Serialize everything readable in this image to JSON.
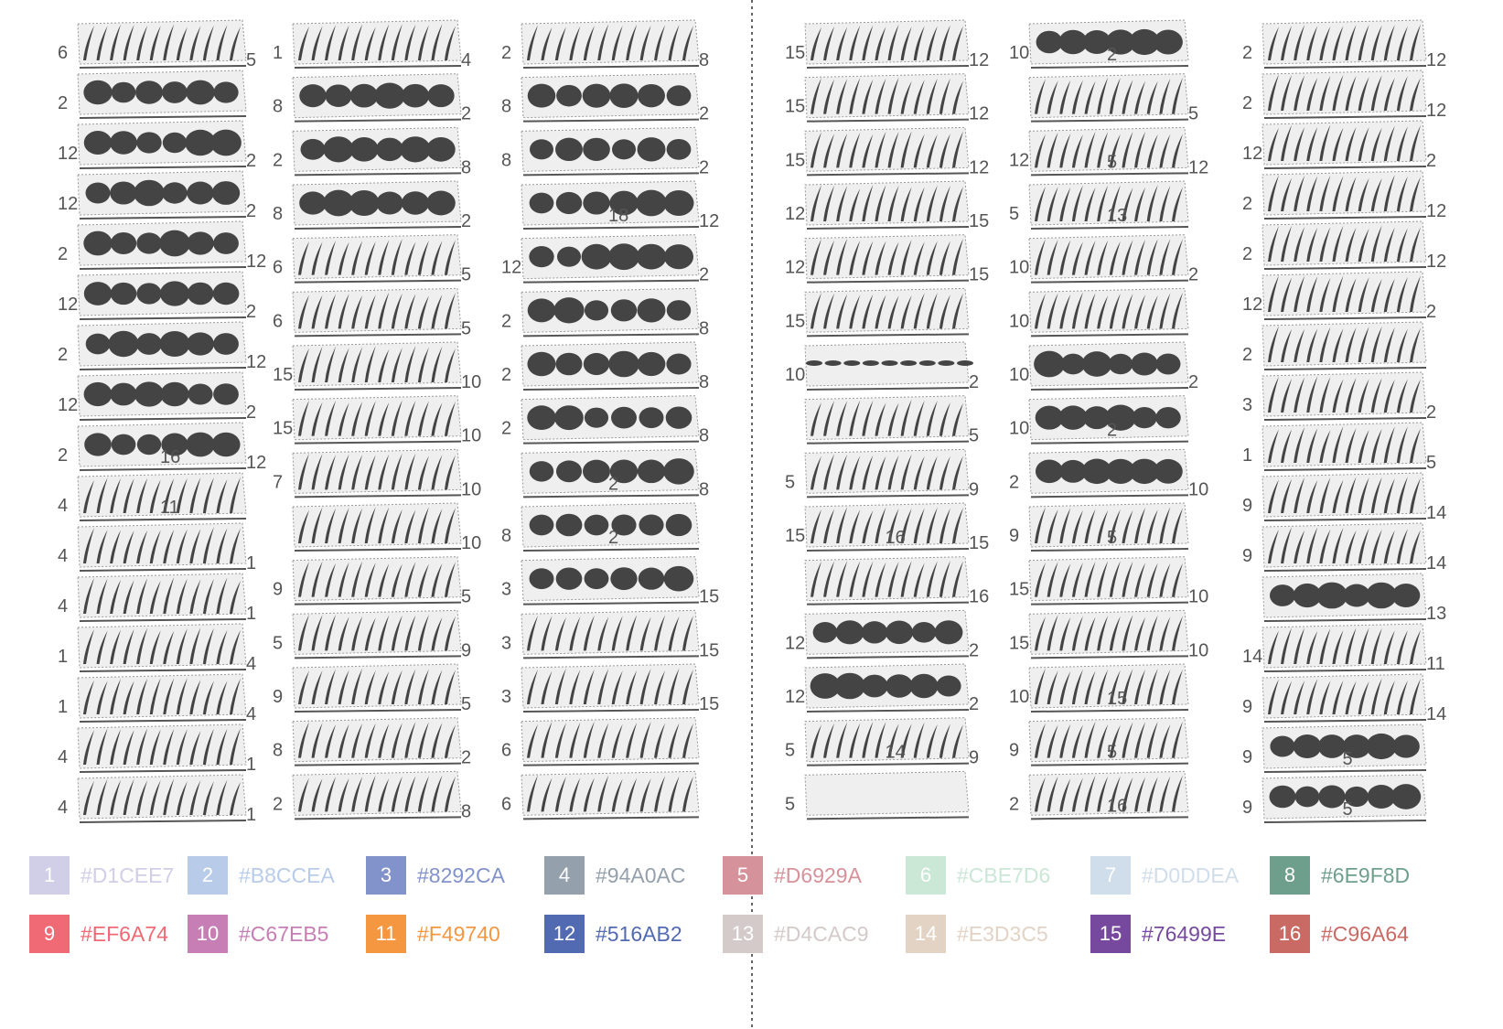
{
  "legend": [
    {
      "num": "1",
      "hex": "#D1CEE7"
    },
    {
      "num": "2",
      "hex": "#B8CCEA"
    },
    {
      "num": "3",
      "hex": "#8292CA"
    },
    {
      "num": "4",
      "hex": "#94A0AC"
    },
    {
      "num": "5",
      "hex": "#D6929A"
    },
    {
      "num": "6",
      "hex": "#CBE7D6"
    },
    {
      "num": "7",
      "hex": "#D0DDEA"
    },
    {
      "num": "8",
      "hex": "#6E9F8D"
    },
    {
      "num": "9",
      "hex": "#EF6A74"
    },
    {
      "num": "10",
      "hex": "#C67EB5"
    },
    {
      "num": "11",
      "hex": "#F49740"
    },
    {
      "num": "12",
      "hex": "#516AB2"
    },
    {
      "num": "13",
      "hex": "#D4CAC9"
    },
    {
      "num": "14",
      "hex": "#E3D3C5"
    },
    {
      "num": "15",
      "hex": "#76499E"
    },
    {
      "num": "16",
      "hex": "#C96A64"
    }
  ],
  "columns": [
    {
      "strips": [
        {
          "t": "s",
          "l": "6",
          "r": "5"
        },
        {
          "t": "b",
          "l": "2",
          "r": ""
        },
        {
          "t": "b",
          "l": "12",
          "r": "2"
        },
        {
          "t": "b",
          "l": "12",
          "r": "2"
        },
        {
          "t": "b",
          "l": "2",
          "r": "12"
        },
        {
          "t": "b",
          "l": "12",
          "r": "2"
        },
        {
          "t": "b",
          "l": "2",
          "r": "12"
        },
        {
          "t": "b",
          "l": "12",
          "r": "2"
        },
        {
          "t": "b",
          "l": "2",
          "r": "12",
          "m": "16"
        },
        {
          "t": "s",
          "l": "4",
          "r": "",
          "m": "11"
        },
        {
          "t": "s",
          "l": "4",
          "r": "1"
        },
        {
          "t": "s",
          "l": "4",
          "r": "1"
        },
        {
          "t": "s",
          "l": "1",
          "r": "4"
        },
        {
          "t": "s",
          "l": "1",
          "r": "4"
        },
        {
          "t": "s",
          "l": "4",
          "r": "1"
        },
        {
          "t": "s",
          "l": "4",
          "r": "1"
        }
      ]
    },
    {
      "strips": [
        {
          "t": "s",
          "l": "1",
          "r": "4"
        },
        {
          "t": "b",
          "l": "8",
          "r": "2"
        },
        {
          "t": "b",
          "l": "2",
          "r": "8"
        },
        {
          "t": "b",
          "l": "8",
          "r": "2"
        },
        {
          "t": "s",
          "l": "6",
          "r": "5"
        },
        {
          "t": "s",
          "l": "6",
          "r": "5"
        },
        {
          "t": "s",
          "l": "15",
          "r": "10"
        },
        {
          "t": "s",
          "l": "15",
          "r": "10"
        },
        {
          "t": "s",
          "l": "7",
          "r": "10"
        },
        {
          "t": "s",
          "l": "",
          "r": "10"
        },
        {
          "t": "s",
          "l": "9",
          "r": "5"
        },
        {
          "t": "s",
          "l": "5",
          "r": "9"
        },
        {
          "t": "s",
          "l": "9",
          "r": "5"
        },
        {
          "t": "s",
          "l": "8",
          "r": "2"
        },
        {
          "t": "s",
          "l": "2",
          "r": "8"
        }
      ]
    },
    {
      "strips": [
        {
          "t": "s",
          "l": "2",
          "r": "8"
        },
        {
          "t": "b",
          "l": "8",
          "r": "2"
        },
        {
          "t": "b",
          "l": "8",
          "r": "2"
        },
        {
          "t": "b",
          "l": "",
          "r": "12",
          "m": "18"
        },
        {
          "t": "b",
          "l": "12",
          "r": "2"
        },
        {
          "t": "b",
          "l": "2",
          "r": "8"
        },
        {
          "t": "b",
          "l": "2",
          "r": "8"
        },
        {
          "t": "b",
          "l": "2",
          "r": "8"
        },
        {
          "t": "b",
          "l": "",
          "r": "8",
          "m": "2"
        },
        {
          "t": "b",
          "l": "8",
          "r": "",
          "m": "2"
        },
        {
          "t": "b",
          "l": "3",
          "r": "15"
        },
        {
          "t": "s",
          "l": "3",
          "r": "15"
        },
        {
          "t": "s",
          "l": "3",
          "r": "15"
        },
        {
          "t": "s",
          "l": "6",
          "r": ""
        },
        {
          "t": "s",
          "l": "6",
          "r": ""
        }
      ]
    },
    {
      "strips": [
        {
          "t": "s",
          "l": "15",
          "r": "12"
        },
        {
          "t": "s",
          "l": "15",
          "r": "12"
        },
        {
          "t": "s",
          "l": "15",
          "r": "12"
        },
        {
          "t": "s",
          "l": "12",
          "r": "15"
        },
        {
          "t": "s",
          "l": "12",
          "r": "15"
        },
        {
          "t": "s",
          "l": "15",
          "r": ""
        },
        {
          "t": "d",
          "l": "10",
          "r": "2"
        },
        {
          "t": "s",
          "l": "",
          "r": "5"
        },
        {
          "t": "s",
          "l": "5",
          "r": "9"
        },
        {
          "t": "s",
          "l": "15",
          "r": "15",
          "m": "16"
        },
        {
          "t": "s",
          "l": "",
          "r": "16"
        },
        {
          "t": "b",
          "l": "12",
          "r": "2"
        },
        {
          "t": "b",
          "l": "12",
          "r": "2"
        },
        {
          "t": "s",
          "l": "5",
          "r": "9",
          "m": "14"
        },
        {
          "t": "e",
          "l": "5",
          "r": ""
        }
      ]
    },
    {
      "strips": [
        {
          "t": "b",
          "l": "10",
          "r": "",
          "m": "2"
        },
        {
          "t": "s",
          "l": "",
          "r": "5"
        },
        {
          "t": "s",
          "l": "12",
          "r": "12",
          "m": "5"
        },
        {
          "t": "s",
          "l": "5",
          "r": "",
          "m": "13"
        },
        {
          "t": "s",
          "l": "10",
          "r": "2"
        },
        {
          "t": "s",
          "l": "10",
          "r": ""
        },
        {
          "t": "b",
          "l": "10",
          "r": "2"
        },
        {
          "t": "b",
          "l": "10",
          "r": "",
          "m": "2"
        },
        {
          "t": "b",
          "l": "2",
          "r": "10"
        },
        {
          "t": "s",
          "l": "9",
          "r": "",
          "m": "5"
        },
        {
          "t": "s",
          "l": "15",
          "r": "10"
        },
        {
          "t": "s",
          "l": "15",
          "r": "10"
        },
        {
          "t": "s",
          "l": "10",
          "r": "",
          "m": "15"
        },
        {
          "t": "s",
          "l": "9",
          "r": "",
          "m": "5"
        },
        {
          "t": "s",
          "l": "2",
          "r": "",
          "m": "16"
        }
      ]
    },
    {
      "strips": [
        {
          "t": "s",
          "l": "2",
          "r": "12"
        },
        {
          "t": "s",
          "l": "2",
          "r": "12"
        },
        {
          "t": "s",
          "l": "12",
          "r": "2"
        },
        {
          "t": "s",
          "l": "2",
          "r": "12"
        },
        {
          "t": "s",
          "l": "2",
          "r": "12"
        },
        {
          "t": "s",
          "l": "12",
          "r": "2"
        },
        {
          "t": "s",
          "l": "2",
          "r": ""
        },
        {
          "t": "s",
          "l": "3",
          "r": "2"
        },
        {
          "t": "s",
          "l": "1",
          "r": "5"
        },
        {
          "t": "s",
          "l": "9",
          "r": "14"
        },
        {
          "t": "s",
          "l": "9",
          "r": "14"
        },
        {
          "t": "b",
          "l": "",
          "r": "13"
        },
        {
          "t": "s",
          "l": "14",
          "r": "11"
        },
        {
          "t": "s",
          "l": "9",
          "r": "14"
        },
        {
          "t": "b",
          "l": "9",
          "r": "",
          "m": "5"
        },
        {
          "t": "b",
          "l": "9",
          "r": "",
          "m": "5"
        }
      ]
    }
  ]
}
